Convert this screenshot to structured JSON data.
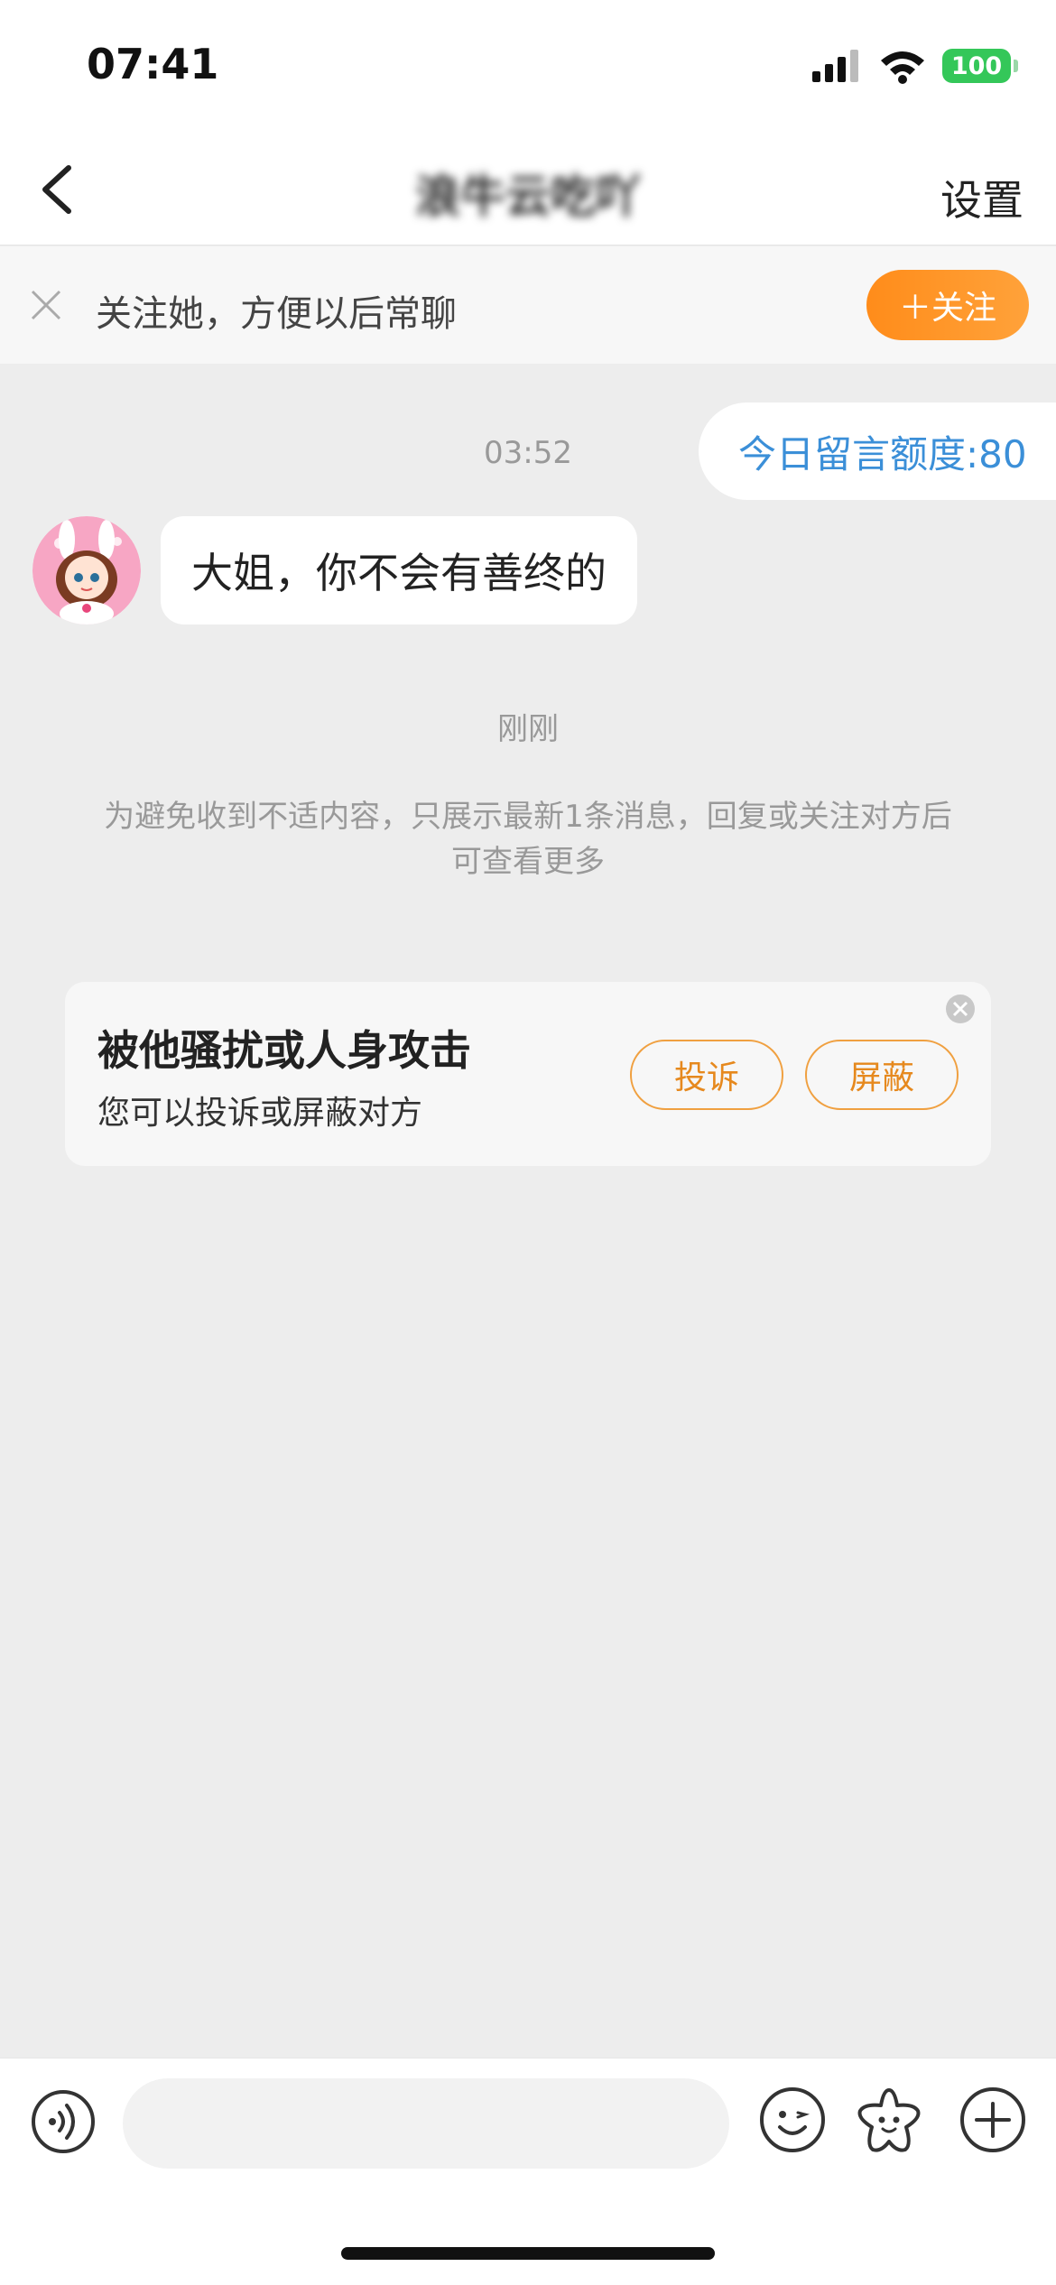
{
  "status_bar": {
    "time": "07:41",
    "battery": "100"
  },
  "nav": {
    "title": "浪牛云吃吖",
    "settings_label": "设置"
  },
  "follow_bar": {
    "text": "关注她，方便以后常聊",
    "button_label": "＋关注"
  },
  "chat": {
    "quota_text": "今日留言额度:80",
    "timestamp_1": "03:52",
    "message_1": "大姐，你不会有善终的",
    "timestamp_2": "刚刚",
    "notice": "为避免收到不适内容，只展示最新1条消息，回复或关注对方后可查看更多"
  },
  "harassment_card": {
    "title": "被他骚扰或人身攻击",
    "subtitle": "您可以投诉或屏蔽对方",
    "report_label": "投诉",
    "block_label": "屏蔽"
  },
  "input_bar": {
    "placeholder": ""
  },
  "colors": {
    "accent_orange": "#ff8c1a",
    "quota_blue": "#3b8fd8",
    "chat_bg": "#ededed"
  },
  "icons": [
    "back-arrow-icon",
    "close-icon",
    "voice-icon",
    "emoji-icon",
    "sticker-icon",
    "plus-icon"
  ]
}
